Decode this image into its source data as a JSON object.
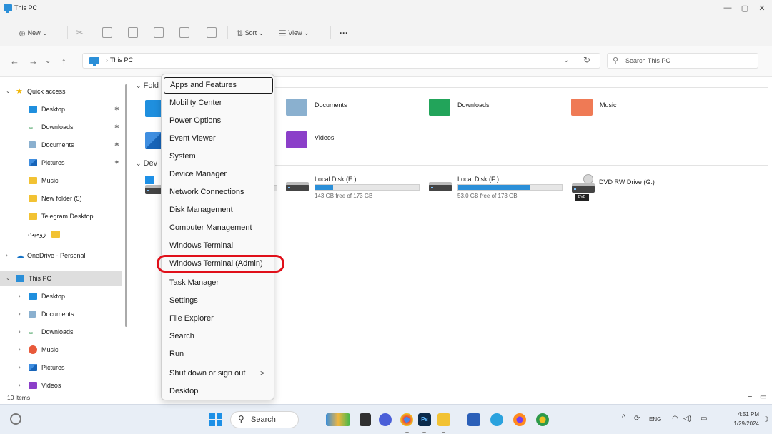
{
  "window": {
    "title": "This PC",
    "minimize": "—",
    "maximize": "▢",
    "close": "✕"
  },
  "toolbar": {
    "new_label": "New",
    "sort_label": "Sort",
    "view_label": "View",
    "more_label": "···",
    "caret": "⌄"
  },
  "address": {
    "back": "←",
    "forward": "→",
    "recent": "⌄",
    "up": "↑",
    "crumb_sep": "›",
    "location": "This PC",
    "dropdown": "⌄",
    "refresh": "↻"
  },
  "search": {
    "placeholder": "Search This PC"
  },
  "sidebar": {
    "quick_access": "Quick access",
    "items": [
      {
        "label": "Desktop",
        "icon": "desktop-icon",
        "pinned": true
      },
      {
        "label": "Downloads",
        "icon": "downloads-icon",
        "pinned": true
      },
      {
        "label": "Documents",
        "icon": "documents-icon",
        "pinned": true
      },
      {
        "label": "Pictures",
        "icon": "pictures-icon",
        "pinned": true
      },
      {
        "label": "Music",
        "icon": "folder-icon",
        "pinned": false
      },
      {
        "label": "New folder (5)",
        "icon": "folder-icon",
        "pinned": false
      },
      {
        "label": "Telegram Desktop",
        "icon": "folder-icon",
        "pinned": false
      },
      {
        "label": "زومیت",
        "icon": "folder-icon",
        "pinned": false
      }
    ],
    "onedrive": "OneDrive - Personal",
    "thispc": "This PC",
    "thispc_children": [
      "Desktop",
      "Documents",
      "Downloads",
      "Music",
      "Pictures",
      "Videos"
    ]
  },
  "content": {
    "folders_heading": "Folders",
    "folders_heading_visible": "Fold",
    "devices_heading_visible": "Dev",
    "folders": [
      "Documents",
      "Downloads",
      "Music",
      "Videos"
    ],
    "drives": [
      {
        "name": "Local Disk (E:)",
        "free": "143 GB free of 173 GB",
        "used_fraction": 0.17
      },
      {
        "name": "Local Disk (F:)",
        "free": "53.0 GB free of 173 GB",
        "used_fraction": 0.69
      }
    ],
    "dvd": {
      "name": "DVD RW Drive (G:)",
      "badge": "DVD"
    }
  },
  "status": {
    "items": "10 items"
  },
  "context_menu": {
    "items": [
      "Apps and Features",
      "Mobility Center",
      "Power Options",
      "Event Viewer",
      "System",
      "Device Manager",
      "Network Connections",
      "Disk Management",
      "Computer Management",
      "Windows Terminal",
      "Windows Terminal (Admin)",
      "Task Manager",
      "Settings",
      "File Explorer",
      "Search",
      "Run",
      "Shut down or sign out",
      "Desktop"
    ],
    "submenu_arrow": ">"
  },
  "taskbar": {
    "search_label": "Search",
    "language": "ENG",
    "time": "4:51 PM",
    "date": "1/29/2024",
    "chevron": "^"
  },
  "colors": {
    "accent": "#2b8fd8",
    "highlight_ring": "#e0101a"
  }
}
